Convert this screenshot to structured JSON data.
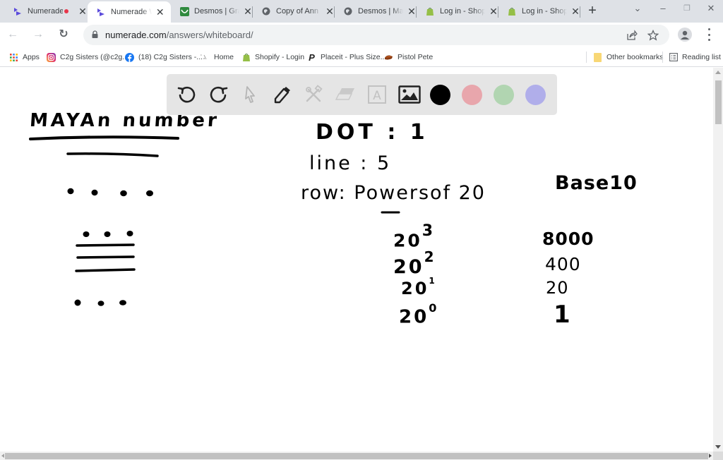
{
  "browser": {
    "tabs": [
      {
        "title": "Numerade",
        "favicon": "numerade-icon",
        "recording": true,
        "active": false
      },
      {
        "title": "Numerade Wh",
        "favicon": "numerade-icon",
        "recording": false,
        "active": true
      },
      {
        "title": "Desmos | Grap",
        "favicon": "desmos-icon",
        "recording": false,
        "active": false
      },
      {
        "title": "Copy of Ann X",
        "favicon": "globe-icon",
        "recording": false,
        "active": false
      },
      {
        "title": "Desmos | Matr",
        "favicon": "globe-icon",
        "recording": false,
        "active": false
      },
      {
        "title": "Log in - Shopi",
        "favicon": "shopify-icon",
        "recording": false,
        "active": false
      },
      {
        "title": "Log in - Shopi",
        "favicon": "shopify-icon",
        "recording": false,
        "active": false
      }
    ],
    "new_tab_label": "+",
    "window_controls": {
      "tab_search": "⌄",
      "minimize": "–",
      "restore": "❐",
      "close": "✕"
    },
    "address": {
      "host": "numerade.com",
      "path": "/answers/whiteboard/"
    },
    "nav": {
      "back": "←",
      "forward": "→",
      "reload": "↻"
    },
    "bookmarks": [
      {
        "label": "Apps",
        "icon": "apps-grid-icon"
      },
      {
        "label": "C2g Sisters (@c2g...",
        "icon": "instagram-icon"
      },
      {
        "label": "(18) C2g Sisters -...",
        "icon": "facebook-icon"
      },
      {
        "label": "Home",
        "icon": "home-site-icon"
      },
      {
        "label": "Shopify - Login",
        "icon": "shopify-icon"
      },
      {
        "label": "Placeit - Plus Size...",
        "icon": "placeit-icon"
      },
      {
        "label": "Pistol Pete",
        "icon": "pistol-pete-icon"
      }
    ],
    "other_bookmarks": "Other bookmarks",
    "reading_list": "Reading list"
  },
  "whiteboard": {
    "tools": [
      {
        "name": "undo",
        "icon": "undo-icon",
        "enabled": true
      },
      {
        "name": "redo",
        "icon": "redo-icon",
        "enabled": true
      },
      {
        "name": "select",
        "icon": "cursor-icon",
        "enabled": false
      },
      {
        "name": "pen",
        "icon": "pencil-icon",
        "enabled": true
      },
      {
        "name": "shapes",
        "icon": "tools-icon",
        "enabled": false
      },
      {
        "name": "eraser",
        "icon": "eraser-icon",
        "enabled": false
      },
      {
        "name": "text",
        "icon": "text-icon",
        "enabled": false
      },
      {
        "name": "image",
        "icon": "image-icon",
        "enabled": true
      }
    ],
    "colors": [
      {
        "name": "black",
        "hex": "#000000",
        "selected": true
      },
      {
        "name": "pink",
        "hex": "#e8a6ac"
      },
      {
        "name": "green",
        "hex": "#b1d5b1"
      },
      {
        "name": "purple",
        "hex": "#b0aeea"
      }
    ],
    "handwriting": {
      "title": "MAYAn number",
      "dot_rule": "DOT : 1",
      "line_rule": "line : 5",
      "row_rule": "row: Powersof 20",
      "powers_header": "",
      "powers": [
        {
          "base": "20",
          "exp": "3"
        },
        {
          "base": "20",
          "exp": "2"
        },
        {
          "base": "20",
          "exp": "1"
        },
        {
          "base": "20",
          "exp": "0"
        }
      ],
      "base10_header": "Base10",
      "base10_values": [
        "8000",
        "400",
        "20",
        "1"
      ],
      "mayan_rows": [
        {
          "dots": 4,
          "bars": 0
        },
        {
          "dots": 3,
          "bars": 3
        },
        {
          "dots": 3,
          "bars": 0
        }
      ]
    }
  }
}
